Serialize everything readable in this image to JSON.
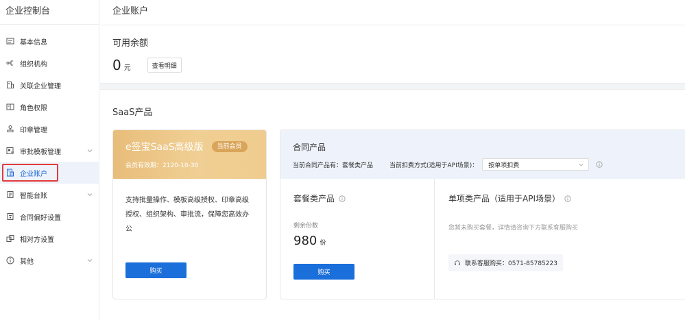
{
  "brand": "企业控制台",
  "sidebar": {
    "items": [
      {
        "label": "基本信息",
        "icon": "id-card-icon"
      },
      {
        "label": "组织机构",
        "icon": "org-tree-icon"
      },
      {
        "label": "关联企业管理",
        "icon": "linked-company-icon"
      },
      {
        "label": "角色权限",
        "icon": "role-permission-icon"
      },
      {
        "label": "印章管理",
        "icon": "seal-icon"
      },
      {
        "label": "审批模板管理",
        "icon": "approval-template-icon"
      },
      {
        "label": "企业账户",
        "icon": "account-icon"
      },
      {
        "label": "智能台账",
        "icon": "ledger-icon"
      },
      {
        "label": "合同偏好设置",
        "icon": "contract-preference-icon"
      },
      {
        "label": "相对方设置",
        "icon": "counterparty-icon"
      },
      {
        "label": "其他",
        "icon": "info-circle-icon"
      }
    ]
  },
  "header": {
    "title": "企业账户"
  },
  "balance": {
    "label": "可用余额",
    "amount": "0",
    "unit": "元",
    "detail_button": "查看明细"
  },
  "saas": {
    "section_title": "SaaS产品",
    "member_card": {
      "title": "e签宝SaaS高级版",
      "badge": "当前会员",
      "expiry": "会员有效期：2120-10-30",
      "description": "支持批量操作、模板高级授权、印章高级授权、组织架构、审批流，保障您高效办公",
      "buy_button": "购买"
    },
    "contract_card": {
      "title": "合同产品",
      "current_products": "当前合同产品有：套餐类产品",
      "deduction_label": "当前扣费方式(适用于API场景)：",
      "deduction_value": "按单项扣费",
      "package": {
        "title": "套餐类产品",
        "remaining_label": "剩余份数",
        "remaining_value": "980",
        "remaining_unit": "份",
        "buy_button": "购买"
      },
      "single": {
        "title": "单项类产品（适用于API场景）",
        "empty_note": "您暂未购买套餐，详情请咨询下方联系客服购买",
        "service": "联系客服购买：0571-85785223"
      }
    }
  },
  "colors": {
    "accent": "#1a6fdb",
    "active_bg": "#eef3fb",
    "active_outline": "#e23a3a",
    "gold": "#e8bd7a"
  }
}
